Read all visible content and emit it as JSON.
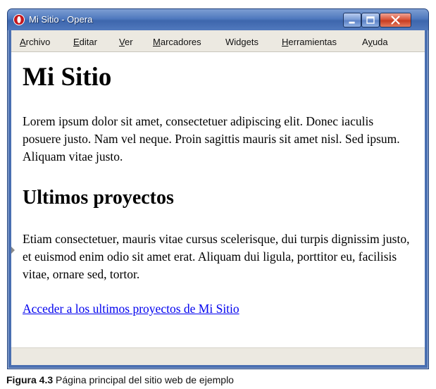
{
  "window": {
    "title": "Mi Sitio - Opera",
    "app_icon": "opera-logo-icon",
    "controls": {
      "minimize_icon": "minimize-icon",
      "maximize_icon": "maximize-icon",
      "close_icon": "close-icon"
    }
  },
  "menu": {
    "items": [
      {
        "id": "archivo",
        "accel": "A",
        "rest": "rchivo"
      },
      {
        "id": "editar",
        "accel": "E",
        "rest": "ditar"
      },
      {
        "id": "ver",
        "accel": "V",
        "rest": "er"
      },
      {
        "id": "marcadores",
        "accel": "M",
        "rest": "arcadores"
      },
      {
        "id": "widgets",
        "accel": "",
        "rest": "Widgets"
      },
      {
        "id": "herramientas",
        "accel": "H",
        "rest": "erramientas"
      },
      {
        "id": "ayuda",
        "accel": "y",
        "pre": "A",
        "rest": "uda"
      }
    ]
  },
  "page": {
    "title": "Mi Sitio",
    "intro": "Lorem ipsum dolor sit amet, consectetuer adipiscing elit. Donec iaculis posuere justo. Nam vel neque. Proin sagittis mauris sit amet nisl. Sed ipsum. Aliquam vitae justo.",
    "section_heading": "Ultimos proyectos",
    "body": "Etiam consectetuer, mauris vitae cursus scelerisque, dui turpis dignissim justo, et euismod enim odio sit amet erat. Aliquam dui ligula, porttitor eu, facilisis vitae, ornare sed, tortor.",
    "link_text": "Acceder a los ultimos proyectos de Mi Sitio"
  },
  "caption": {
    "label": "Figura 4.3",
    "text": "Página principal del sitio web de ejemplo"
  },
  "colors": {
    "titlebar": "#4f79be",
    "link": "#0000ee",
    "close_button": "#d9553b",
    "menubar": "#ece9e1"
  }
}
